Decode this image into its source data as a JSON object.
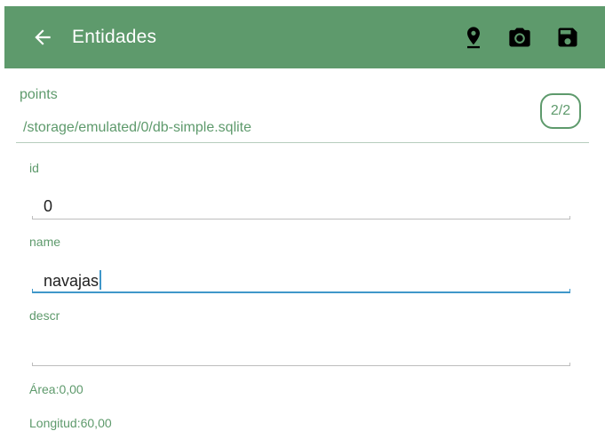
{
  "appbar": {
    "title": "Entidades",
    "back_icon": "arrow-left-icon",
    "actions": [
      {
        "name": "location-pin-icon"
      },
      {
        "name": "camera-icon"
      },
      {
        "name": "save-icon"
      }
    ],
    "color": "#5e9a6c"
  },
  "header": {
    "table_name": "points",
    "database_path": "/storage/emulated/0/db-simple.sqlite",
    "counter": "2/2"
  },
  "fields": [
    {
      "label": "id",
      "value": "0"
    },
    {
      "label": "name",
      "value": "navajas"
    },
    {
      "label": "descr",
      "value": ""
    }
  ],
  "info": {
    "area": "Área:0,00",
    "longitude": "Longitud:60,00"
  },
  "colors": {
    "accent": "#5e9a6c",
    "focus": "#3f97c9"
  }
}
